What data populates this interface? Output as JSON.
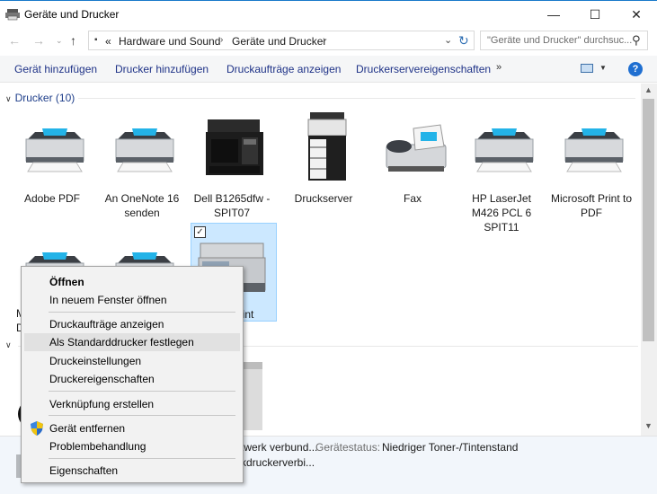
{
  "window": {
    "title": "Geräte und Drucker",
    "controls": {
      "minimize": "—",
      "maximize": "☐",
      "close": "✕"
    }
  },
  "address": {
    "breadcrumbs": [
      "Hardware und Sound",
      "Geräte und Drucker"
    ],
    "lead": "«",
    "search_placeholder": "\"Geräte und Drucker\" durchsuc..."
  },
  "toolbar": {
    "items": [
      "Gerät hinzufügen",
      "Drucker hinzufügen",
      "Druckaufträge anzeigen",
      "Druckerservereigenschaften"
    ],
    "more": "»",
    "help": "?"
  },
  "groups": {
    "printers_header": "Drucker (10)"
  },
  "printers": [
    {
      "label": "Adobe PDF",
      "icon": "printer-icon"
    },
    {
      "label": "An OneNote 16 senden",
      "icon": "printer-icon"
    },
    {
      "label": "Dell B1265dfw - SPIT07",
      "icon": "mfp-printer-icon"
    },
    {
      "label": "Druckserver",
      "icon": "copier-icon"
    },
    {
      "label": "Fax",
      "icon": "fax-icon"
    },
    {
      "label": "HP LaserJet M426 PCL 6 SPIT11",
      "icon": "printer-icon"
    },
    {
      "label": "Microsoft Print to PDF",
      "icon": "printer-icon"
    },
    {
      "label": "M",
      "icon": "printer-icon"
    },
    {
      "label": "D",
      "icon": "printer-icon"
    },
    {
      "label": "print",
      "icon": "laser-printer-icon"
    }
  ],
  "context_menu": {
    "open": "Öffnen",
    "open_new_window": "In neuem Fenster öffnen",
    "show_jobs": "Druckaufträge anzeigen",
    "set_default": "Als Standarddrucker festlegen",
    "settings": "Druckeinstellungen",
    "properties_printer": "Druckereigenschaften",
    "create_shortcut": "Verknüpfung erstellen",
    "remove_device": "Gerät entfernen",
    "troubleshoot": "Problembehandlung",
    "properties": "Eigenschaften"
  },
  "details": {
    "line1_value": "twerk verbund...",
    "status_key": "Gerätestatus:",
    "status_value": "Niedriger Toner-/Tintenstand",
    "line2_value": "kdruckerverbi..."
  },
  "colors": {
    "accent_link": "#1e3287",
    "selection_bg": "#cce8ff",
    "selection_border": "#99d1ff",
    "group_header": "#1e3e8a",
    "details_bg": "#f2f6fb"
  }
}
